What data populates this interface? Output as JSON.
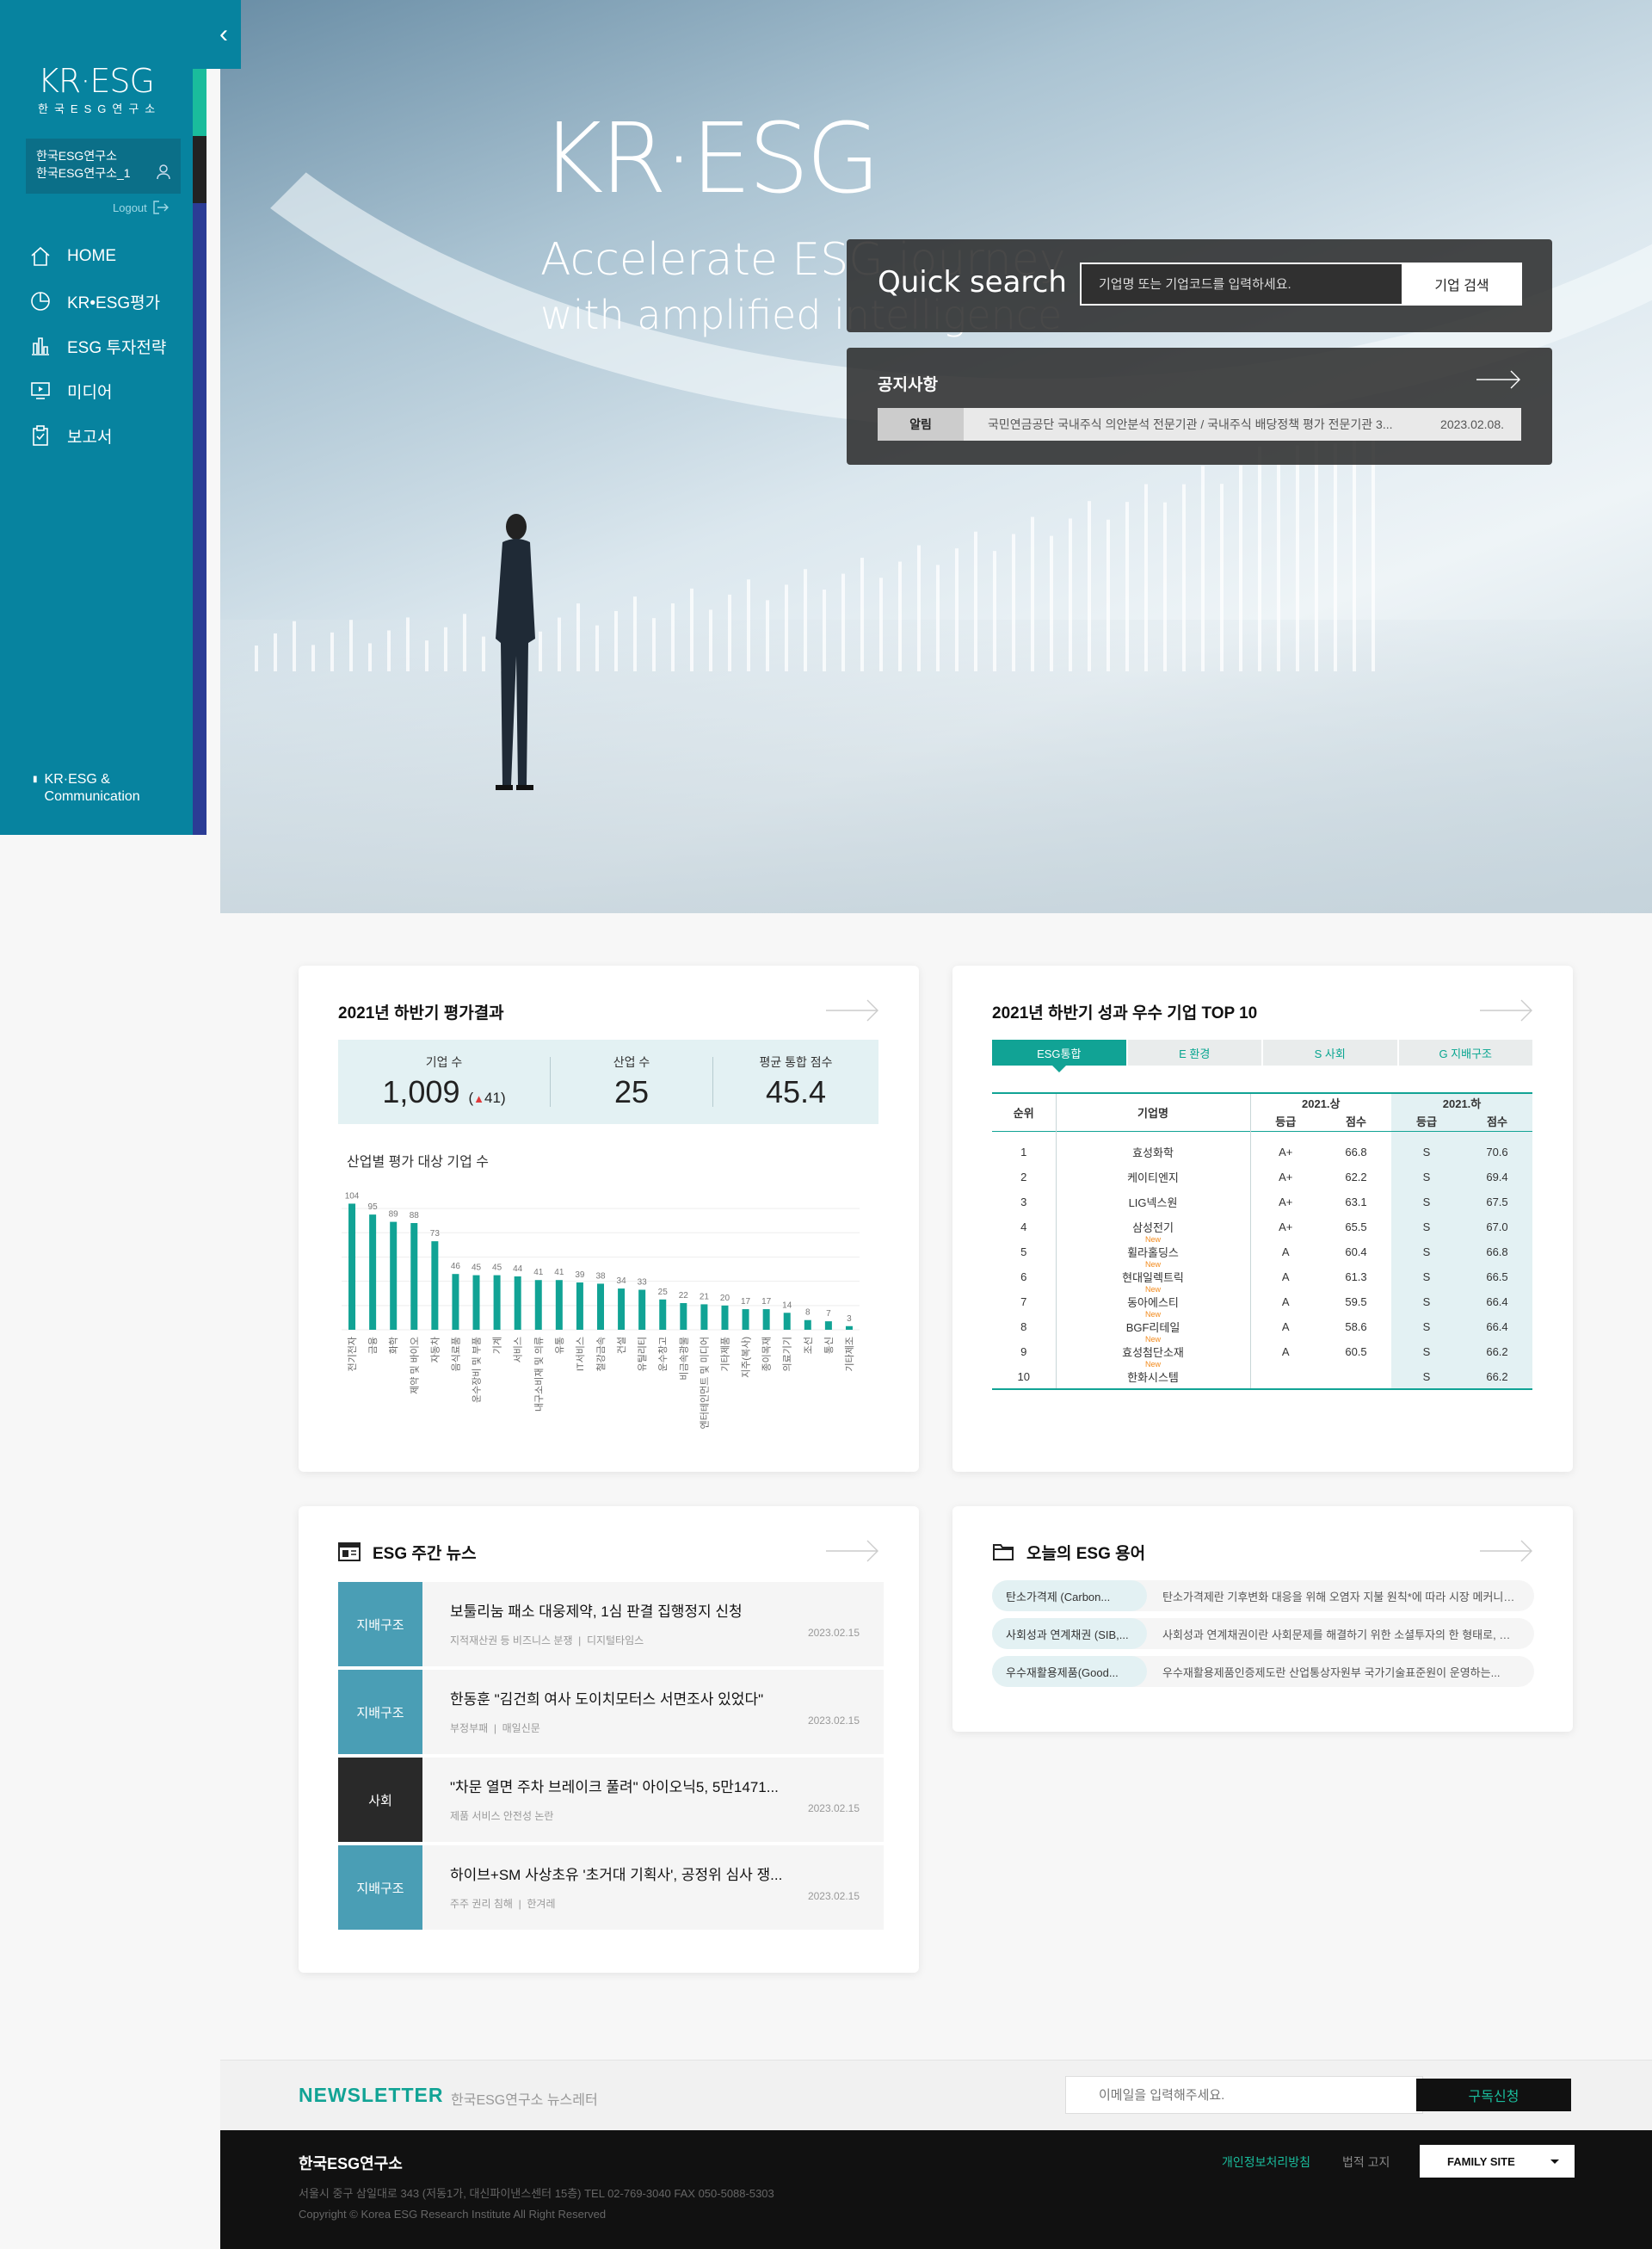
{
  "sidebar": {
    "logo_main": "KR·ESG",
    "logo_sub": "한국ESG연구소",
    "user_org": "한국ESG연구소",
    "user_id": "한국ESG연구소_1",
    "logout": "Logout",
    "nav": [
      {
        "label": "HOME",
        "icon": "home-icon"
      },
      {
        "label": "KR•ESG평가",
        "icon": "pie-chart-icon"
      },
      {
        "label": "ESG 투자전략",
        "icon": "bar-chart-icon"
      },
      {
        "label": "미디어",
        "icon": "monitor-play-icon"
      },
      {
        "label": "보고서",
        "icon": "clipboard-icon"
      }
    ],
    "footer_label_1": "KR·ESG &",
    "footer_label_2": "Communication"
  },
  "hero": {
    "logo": "KR·ESG",
    "tagline_1": "Accelerate ESG journey",
    "tagline_2": "with amplified intelligence",
    "quick_search": {
      "title": "Quick search",
      "placeholder": "기업명 또는 기업코드를 입력하세요.",
      "button": "기업 검색"
    },
    "notice": {
      "title": "공지사항",
      "badge": "알림",
      "text": "국민연금공단 국내주식 의안분석 전문기관 / 국내주식 배당정책 평가 전문기관 3...",
      "date": "2023.02.08."
    }
  },
  "eval": {
    "title": "2021년 하반기 평가결과",
    "stats": [
      {
        "label": "기업 수",
        "value": "1,009",
        "delta": "41"
      },
      {
        "label": "산업 수",
        "value": "25"
      },
      {
        "label": "평균 통합 점수",
        "value": "45.4"
      }
    ],
    "chart_title": "산업별 평가 대상 기업 수"
  },
  "chart_data": {
    "type": "bar",
    "title": "산업별 평가 대상 기업 수",
    "categories": [
      "전기전자",
      "금융",
      "화학",
      "제약 및 바이오",
      "자동차",
      "음식료품",
      "운수장비 및 부품",
      "기계",
      "서비스",
      "내구소비재 및 의류",
      "유통",
      "IT서비스",
      "철강금속",
      "건설",
      "유틸리티",
      "운수창고",
      "비금속광물",
      "엔터테인먼트 및 미디어",
      "기타제품",
      "지주(복사)",
      "종이목재",
      "의료기기",
      "조선",
      "통신",
      "기타제조"
    ],
    "values": [
      104,
      95,
      89,
      88,
      73,
      46,
      45,
      45,
      44,
      41,
      41,
      39,
      38,
      34,
      33,
      25,
      22,
      21,
      20,
      17,
      17,
      14,
      8,
      7,
      3
    ],
    "color": "#11a395",
    "grid": true
  },
  "top10": {
    "title": "2021년 하반기 성과 우수 기업 TOP 10",
    "tabs": [
      "ESG통합",
      "E 환경",
      "S 사회",
      "G 지배구조"
    ],
    "headers": {
      "rank": "순위",
      "company": "기업명",
      "period1": "2021.상",
      "period2": "2021.하",
      "grade": "등급",
      "score": "점수"
    },
    "new_label": "New",
    "rows": [
      {
        "rank": "1",
        "name": "효성화학",
        "g1": "A+",
        "s1": "66.8",
        "g2": "S",
        "s2": "70.6",
        "is_new": false
      },
      {
        "rank": "2",
        "name": "케이티엔지",
        "g1": "A+",
        "s1": "62.2",
        "g2": "S",
        "s2": "69.4",
        "is_new": false
      },
      {
        "rank": "3",
        "name": "LIG넥스원",
        "g1": "A+",
        "s1": "63.1",
        "g2": "S",
        "s2": "67.5",
        "is_new": false
      },
      {
        "rank": "4",
        "name": "삼성전기",
        "g1": "A+",
        "s1": "65.5",
        "g2": "S",
        "s2": "67.0",
        "is_new": false
      },
      {
        "rank": "5",
        "name": "휠라홀딩스",
        "g1": "A",
        "s1": "60.4",
        "g2": "S",
        "s2": "66.8",
        "is_new": true
      },
      {
        "rank": "6",
        "name": "현대일렉트릭",
        "g1": "A",
        "s1": "61.3",
        "g2": "S",
        "s2": "66.5",
        "is_new": true
      },
      {
        "rank": "7",
        "name": "동아에스티",
        "g1": "A",
        "s1": "59.5",
        "g2": "S",
        "s2": "66.4",
        "is_new": true
      },
      {
        "rank": "8",
        "name": "BGF리테일",
        "g1": "A",
        "s1": "58.6",
        "g2": "S",
        "s2": "66.4",
        "is_new": true
      },
      {
        "rank": "9",
        "name": "효성첨단소재",
        "g1": "A",
        "s1": "60.5",
        "g2": "S",
        "s2": "66.2",
        "is_new": true
      },
      {
        "rank": "10",
        "name": "한화시스템",
        "g1": "",
        "s1": "",
        "g2": "S",
        "s2": "66.2",
        "is_new": true
      }
    ]
  },
  "news": {
    "title": "ESG 주간 뉴스",
    "items": [
      {
        "cat": "지배구조",
        "title": "보툴리눔 패소 대웅제약, 1심 판결 집행정지 신청",
        "tag": "지적재산권 등 비즈니스 분쟁",
        "source": "디지털타임스",
        "date": "2023.02.15"
      },
      {
        "cat": "지배구조",
        "title": "한동훈 \"김건희 여사 도이치모터스 서면조사 있었다\"",
        "tag": "부정부패",
        "source": "매일신문",
        "date": "2023.02.15"
      },
      {
        "cat": "사회",
        "title": "\"차문 열면 주차 브레이크 풀려\" 아이오닉5, 5만1471...",
        "tag": "제품 서비스 안전성 논란",
        "source": "",
        "date": "2023.02.15"
      },
      {
        "cat": "지배구조",
        "title": "하이브+SM 사상초유 '초거대 기획사', 공정위 심사 쟁...",
        "tag": "주주 권리 침해",
        "source": "한겨레",
        "date": "2023.02.15"
      }
    ]
  },
  "glossary": {
    "title": "오늘의 ESG 용어",
    "items": [
      {
        "term": "탄소가격제 (Carbon...",
        "desc": "탄소가격제란 기후변화 대응을 위해 오염자 지불 원칙*에 따라 시장 메커니즘..."
      },
      {
        "term": "사회성과 연계채권 (SIB,...",
        "desc": "사회성과 연계채권이란 사회문제를 해결하기 위한 소셜투자의 한 형태로, 교육,..."
      },
      {
        "term": "우수재활용제품(Good...",
        "desc": "우수재활용제품인증제도란 산업통상자원부 국가기술표준원이 운영하는..."
      }
    ]
  },
  "newsletter": {
    "title": "NEWSLETTER",
    "sub": "한국ESG연구소 뉴스레터",
    "placeholder": "이메일을 입력해주세요.",
    "button": "구독신청"
  },
  "footer": {
    "name": "한국ESG연구소",
    "address": "서울시 중구 삼일대로 343 (저동1가, 대신파이낸스센터 15층) TEL 02-769-3040 FAX 050-5088-5303",
    "copyright": "Copyright © Korea ESG Research Institute All Right Reserved",
    "privacy": "개인정보처리방침",
    "legal": "법적 고지",
    "family_site": "FAMILY SITE"
  }
}
